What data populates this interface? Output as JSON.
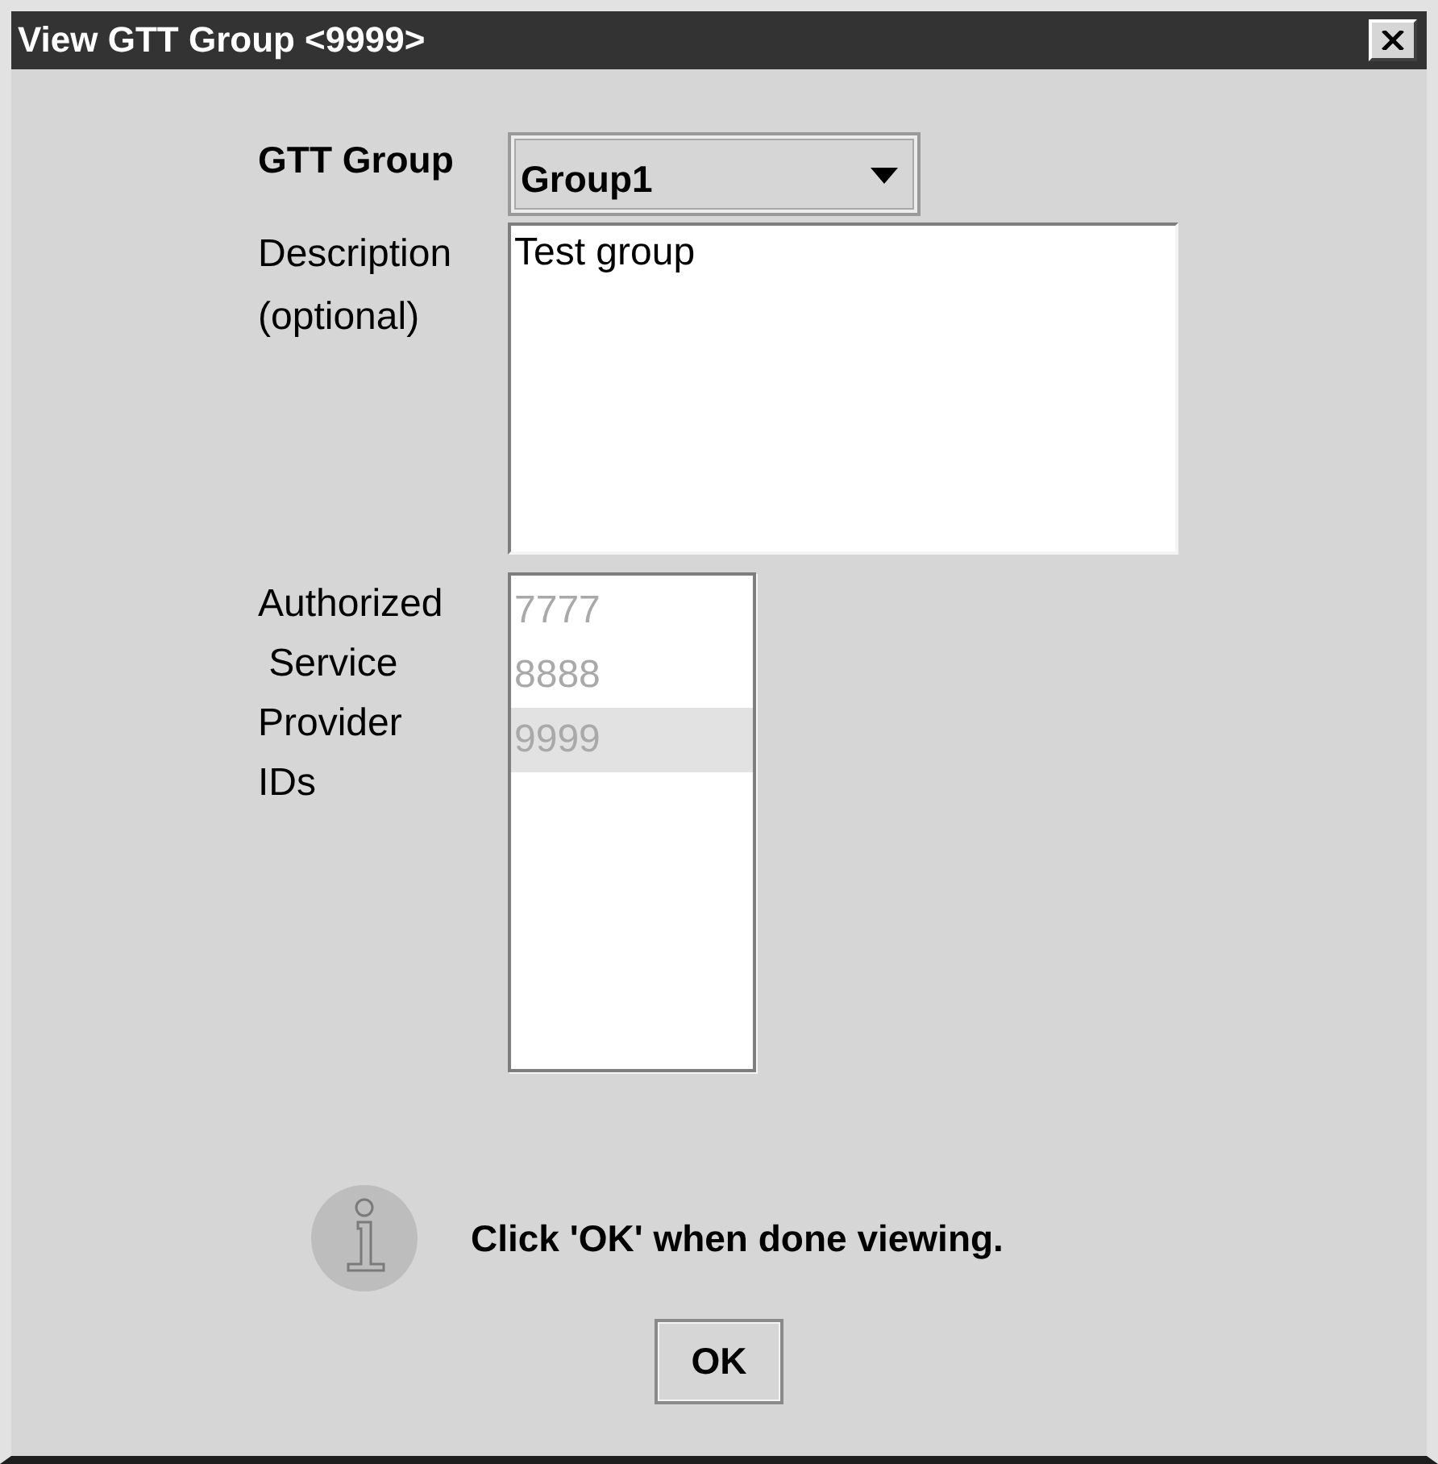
{
  "window": {
    "title": "View GTT Group <9999>"
  },
  "form": {
    "gtt_group": {
      "label": "GTT Group",
      "value": "Group1"
    },
    "description": {
      "label": "Description\n(optional)",
      "value": "Test group"
    },
    "service_provider_ids": {
      "label": "Authorized\n Service\nProvider\nIDs",
      "disabled": true,
      "items": [
        {
          "label": "7777",
          "selected": false
        },
        {
          "label": "8888",
          "selected": false
        },
        {
          "label": "9999",
          "selected": true
        }
      ]
    }
  },
  "message": {
    "kind": "info",
    "text": "Click 'OK' when done viewing."
  },
  "buttons": [
    {
      "label": "OK"
    }
  ]
}
